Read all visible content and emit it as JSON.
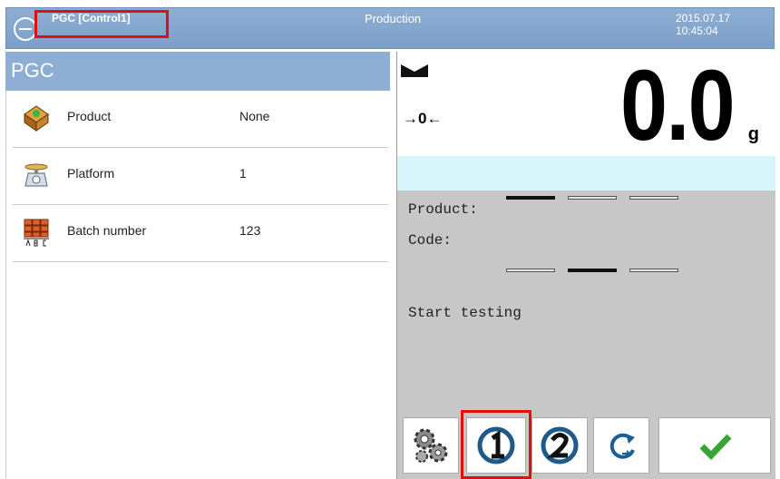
{
  "header": {
    "title": "PGC [Control1]",
    "mode": "Production",
    "date": "2015.07.17",
    "time": "10:45:04"
  },
  "left": {
    "heading": "PGC",
    "items": [
      {
        "label": "Product",
        "value": "None",
        "icon": "product-icon"
      },
      {
        "label": "Platform",
        "value": "1",
        "icon": "scale-platform-icon"
      },
      {
        "label": "Batch number",
        "value": "123",
        "icon": "batch-abc-icon"
      }
    ]
  },
  "weighing": {
    "value": "0.0",
    "unit": "g",
    "zero_indicator": "→0←",
    "stable_icon": "stability-marker-icon"
  },
  "info": {
    "product_label": "Product:",
    "code_label": "Code:",
    "status": "Start testing"
  },
  "buttons": [
    {
      "name": "settings-gears-button",
      "icon": "gears-icon"
    },
    {
      "name": "control-1-button",
      "icon": "circle-1-icon"
    },
    {
      "name": "control-2-button",
      "icon": "circle-2-icon"
    },
    {
      "name": "refresh-button",
      "icon": "refresh-icon"
    },
    {
      "name": "confirm-button",
      "icon": "check-icon"
    }
  ],
  "colors": {
    "header": "#8eaed3",
    "highlight": "#e01010",
    "accent_green": "#3aa335",
    "cyan_band": "#d7f5fb"
  }
}
